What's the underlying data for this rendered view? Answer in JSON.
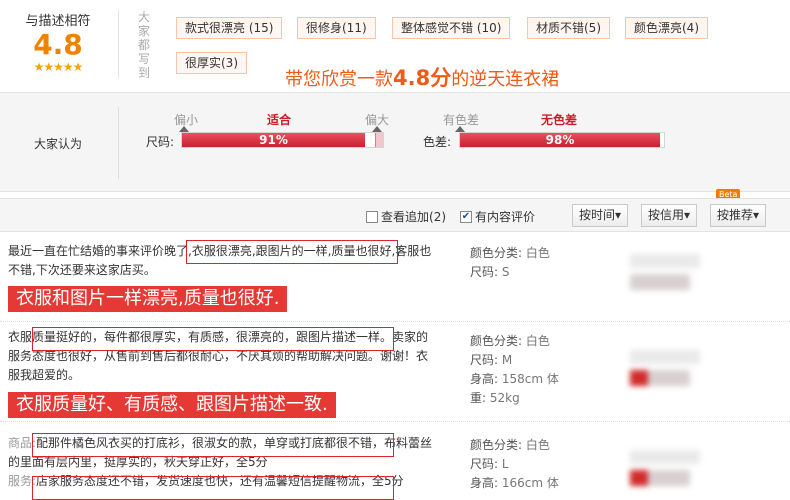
{
  "rating": {
    "title": "与描述相符",
    "score": "4.8",
    "stars": "★★★★★",
    "vertical_label": "大家都写到"
  },
  "tags": [
    "款式很漂亮 (15)",
    "很修身(11)",
    "整体感觉不错 (10)",
    "材质不错(5)",
    "颜色漂亮(4)",
    "很厚实(3)"
  ],
  "headline": {
    "prefix": "带您欣赏一款",
    "highlight": "4.8分",
    "suffix": "的逆天连衣裙"
  },
  "fit": {
    "label": "大家认为",
    "size": {
      "row_label": "尺码:",
      "left": "偏小",
      "middle": "适合",
      "right": "偏大",
      "percent_text": "91%",
      "fraction": 0.91
    },
    "color": {
      "row_label": "色差:",
      "left": "有色差",
      "middle": "无色差",
      "percent_text": "98%",
      "fraction": 0.98
    }
  },
  "filter": {
    "follow_up": "查看追加",
    "follow_up_count": "(2)",
    "follow_up_checked": false,
    "with_content": "有内容评价",
    "with_content_checked": true,
    "sort_time": "按时间",
    "sort_credit": "按信用",
    "sort_recommend": "按推荐",
    "beta": "Beta",
    "arrow": "▾"
  },
  "reviews": [
    {
      "text": "最近一直在忙结婚的事来评价晚了,衣服很漂亮,跟图片的一样,质量也很好,客服也不错,下次还要来这家店买。",
      "banner": "衣服和图片一样漂亮,质量也很好.",
      "meta": [
        {
          "k": "颜色分类:",
          "v": "白色"
        },
        {
          "k": "尺码:",
          "v": "S"
        }
      ]
    },
    {
      "text": "衣服质量挺好的，每件都很厚实，有质感，很漂亮的，跟图片描述一样。卖家的服务态度也很好，从售前到售后都很耐心，不厌其烦的帮助解决问题。谢谢！衣服我超爱的。",
      "banner": "衣服质量好、有质感、跟图片描述一致.",
      "meta": [
        {
          "k": "颜色分类:",
          "v": "白色"
        },
        {
          "k": "尺码:",
          "v": "M"
        },
        {
          "k": "身高:",
          "v": "158cm 体"
        },
        {
          "k": "重:",
          "v": "52kg"
        }
      ]
    },
    {
      "goods_label": "商品:",
      "text": "配那件橘色风衣买的打底衫，很淑女的款，单穿或打底都很不错，布料蕾丝的里面有层内里，挺厚实的，秋天穿正好，全5分",
      "service_label": "服务:",
      "service_text": "店家服务态度还不错，发货速度也快，还有温馨短信提醒物流，全5分",
      "meta": [
        {
          "k": "颜色分类:",
          "v": "白色"
        },
        {
          "k": "尺码:",
          "v": "L"
        },
        {
          "k": "身高:",
          "v": "166cm 体"
        }
      ]
    }
  ]
}
